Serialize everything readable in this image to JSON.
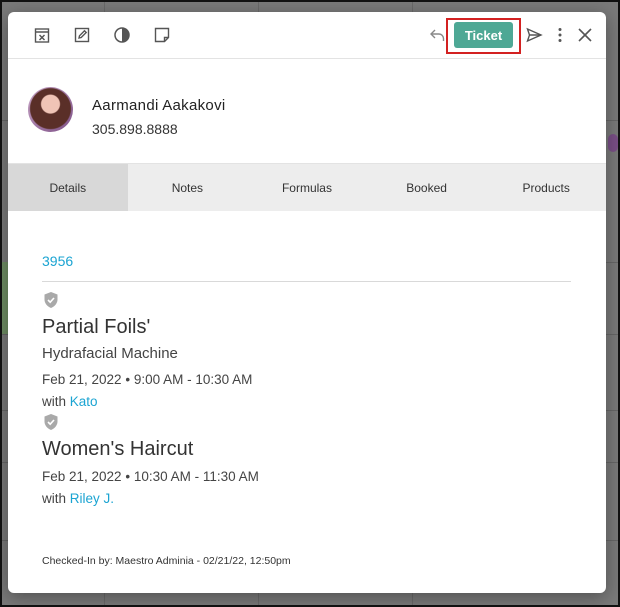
{
  "toolbar": {
    "icons": [
      "calendar-cancel-icon",
      "edit-icon",
      "contrast-icon",
      "note-icon"
    ],
    "right_icons": [
      "reply-icon",
      "send-icon",
      "more-vertical-icon",
      "close-icon"
    ],
    "ticket_label": "Ticket"
  },
  "client": {
    "name": "Aarmandi Aakakovi",
    "phone": "305.898.8888"
  },
  "tabs": [
    {
      "label": "Details",
      "active": true
    },
    {
      "label": "Notes",
      "active": false
    },
    {
      "label": "Formulas",
      "active": false
    },
    {
      "label": "Booked",
      "active": false
    },
    {
      "label": "Products",
      "active": false
    }
  ],
  "details": {
    "ticket_number": "3956",
    "services": [
      {
        "name": "Partial Foils'",
        "resource": "Hydrafacial Machine",
        "date": "Feb 21, 2022",
        "time": "9:00 AM - 10:30 AM",
        "with_label": "with",
        "staff": "Kato"
      },
      {
        "name": "Women's Haircut",
        "resource": "",
        "date": "Feb 21, 2022",
        "time": "10:30 AM - 11:30 AM",
        "with_label": "with",
        "staff": "Riley J."
      }
    ],
    "checked_in": "Checked-In by: Maestro Adminia - 02/21/22, 12:50pm"
  },
  "colors": {
    "accent": "#4ea895",
    "link": "#1ba4d2",
    "highlight": "#d32121"
  }
}
